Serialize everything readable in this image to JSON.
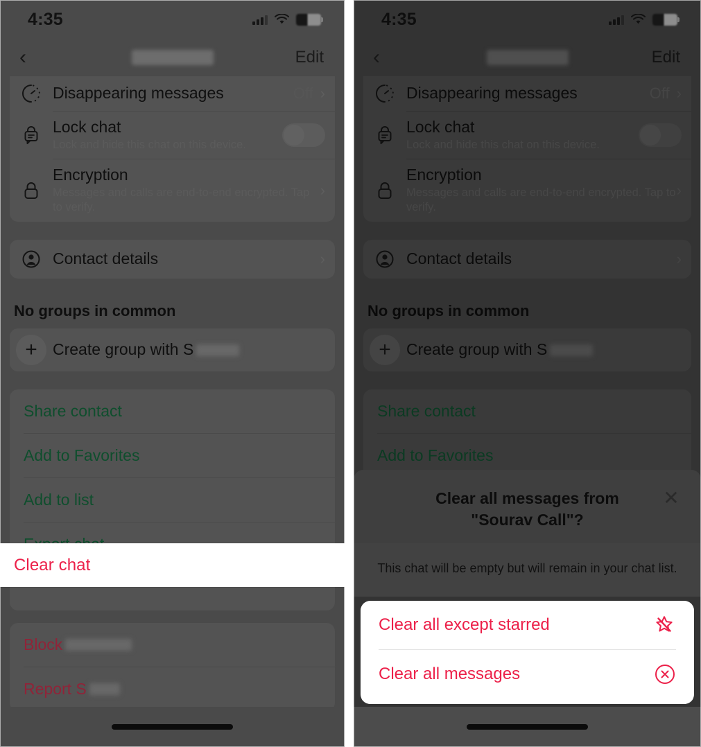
{
  "status_bar": {
    "time": "4:35",
    "icons": [
      "cellular-signal-icon",
      "wifi-icon",
      "battery-icon"
    ]
  },
  "nav": {
    "back_icon": "back-chevron-icon",
    "title_redacted": "",
    "edit_label": "Edit"
  },
  "settings": {
    "disappearing_messages": {
      "title": "Disappearing messages",
      "value": "Off",
      "icon": "timer-icon"
    },
    "lock_chat": {
      "title": "Lock chat",
      "subtitle": "Lock and hide this chat on this device.",
      "icon": "lock-chat-icon",
      "toggle_state": "off"
    },
    "encryption": {
      "title": "Encryption",
      "subtitle": "Messages and calls are end-to-end encrypted. Tap to verify.",
      "icon": "padlock-icon"
    },
    "contact_details": {
      "title": "Contact details",
      "icon": "contact-avatar-icon"
    }
  },
  "groups": {
    "header": "No groups in common",
    "create_group_prefix": "Create group with ",
    "create_group_partial_name": "S",
    "plus_icon": "plus-icon"
  },
  "actions": {
    "share_contact": "Share contact",
    "add_to_favorites": "Add to Favorites",
    "add_to_list": "Add to list",
    "export_chat": "Export chat",
    "clear_chat": "Clear chat",
    "block": "Block",
    "report": "Report S"
  },
  "dialog": {
    "title_line1": "Clear all messages from",
    "title_line2": "\"Sourav Call\"?",
    "body": "This chat will be empty but will remain in your chat list.",
    "close_icon": "close-x-icon",
    "options": [
      {
        "label": "Clear all except starred",
        "icon": "star-slash-icon"
      },
      {
        "label": "Clear all messages",
        "icon": "x-circle-icon"
      }
    ]
  },
  "colors": {
    "destructive": "#ec2049",
    "link_green": "#0f4e2d",
    "panel_dim_left": "#4a4a4a",
    "panel_dim_right": "#333333",
    "highlight": "#ffffff"
  }
}
